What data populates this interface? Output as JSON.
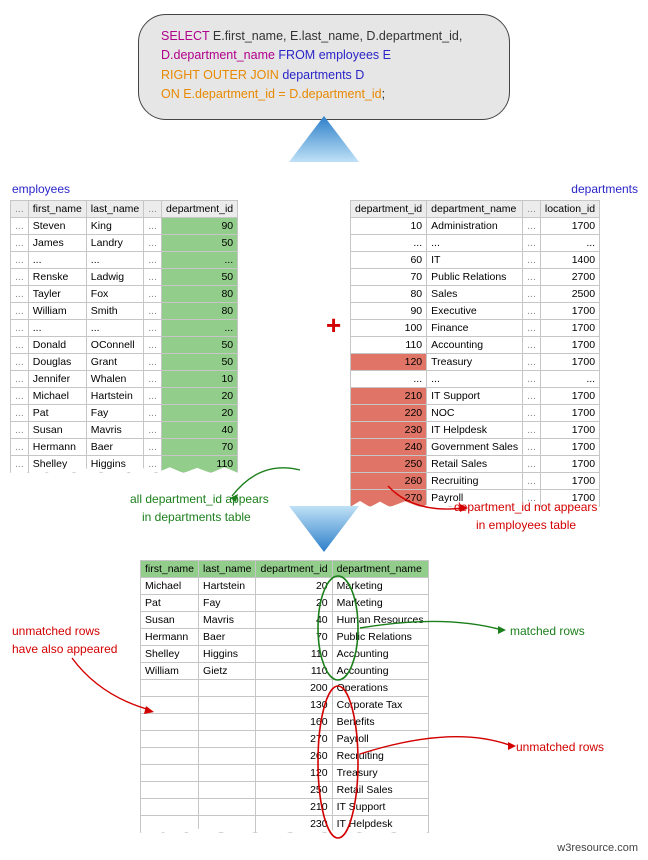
{
  "sql": {
    "line1a": "SELECT",
    "line1b": " E.first_name, E.last_name, D.department_id,",
    "line2a": "D.department_name",
    "line2b": " FROM ",
    "line2c": "employees E",
    "line3a": "RIGHT OUTER JOIN",
    "line3b": " departments D",
    "line4a": "ON",
    "line4b": " E.department_id = D.department_id",
    "line4c": ";"
  },
  "labels": {
    "employees": "employees",
    "departments": "departments",
    "plus": "+",
    "credit": "w3resource.com"
  },
  "annotations": {
    "a1a": "all department_id appears",
    "a1b": "in departments table",
    "a2a": "department_id not appears",
    "a2b": "in employees table",
    "a3a": "unmatched rows",
    "a3b": "have also appeared",
    "a4": "matched rows",
    "a5": "unmatched rows"
  },
  "employees": {
    "cols": [
      "first_name",
      "last_name",
      "department_id"
    ],
    "rows": [
      {
        "fn": "Steven",
        "ln": "King",
        "d": 90
      },
      {
        "fn": "James",
        "ln": "Landry",
        "d": 50
      },
      {
        "gap": true
      },
      {
        "fn": "Renske",
        "ln": "Ladwig",
        "d": 50
      },
      {
        "fn": "Tayler",
        "ln": "Fox",
        "d": 80
      },
      {
        "fn": "William",
        "ln": "Smith",
        "d": 80
      },
      {
        "gap": true
      },
      {
        "fn": "Donald",
        "ln": "OConnell",
        "d": 50
      },
      {
        "fn": "Douglas",
        "ln": "Grant",
        "d": 50
      },
      {
        "fn": "Jennifer",
        "ln": "Whalen",
        "d": 10
      },
      {
        "fn": "Michael",
        "ln": "Hartstein",
        "d": 20
      },
      {
        "fn": "Pat",
        "ln": "Fay",
        "d": 20
      },
      {
        "fn": "Susan",
        "ln": "Mavris",
        "d": 40
      },
      {
        "fn": "Hermann",
        "ln": "Baer",
        "d": 70
      },
      {
        "fn": "Shelley",
        "ln": "Higgins",
        "d": 110
      }
    ]
  },
  "departments": {
    "cols": [
      "department_id",
      "department_name",
      "location_id"
    ],
    "rows": [
      {
        "id": 10,
        "name": "Administration",
        "loc": 1700
      },
      {
        "gap": true
      },
      {
        "id": 60,
        "name": "IT",
        "loc": 1400
      },
      {
        "id": 70,
        "name": "Public Relations",
        "loc": 2700
      },
      {
        "id": 80,
        "name": "Sales",
        "loc": 2500
      },
      {
        "id": 90,
        "name": "Executive",
        "loc": 1700
      },
      {
        "id": 100,
        "name": "Finance",
        "loc": 1700
      },
      {
        "id": 110,
        "name": "Accounting",
        "loc": 1700
      },
      {
        "id": 120,
        "name": "Treasury",
        "loc": 1700,
        "hl": true
      },
      {
        "gap": true
      },
      {
        "id": 210,
        "name": "IT Support",
        "loc": 1700,
        "hl": true
      },
      {
        "id": 220,
        "name": "NOC",
        "loc": 1700,
        "hl": true
      },
      {
        "id": 230,
        "name": "IT Helpdesk",
        "loc": 1700,
        "hl": true
      },
      {
        "id": 240,
        "name": "Government Sales",
        "loc": 1700,
        "hl": true
      },
      {
        "id": 250,
        "name": "Retail Sales",
        "loc": 1700,
        "hl": true
      },
      {
        "id": 260,
        "name": "Recruiting",
        "loc": 1700,
        "hl": true
      },
      {
        "id": 270,
        "name": "Payroll",
        "loc": 1700,
        "hl": true
      }
    ]
  },
  "result": {
    "cols": [
      "first_name",
      "last_name",
      "department_id",
      "department_name"
    ],
    "rows": [
      {
        "fn": "Michael",
        "ln": "Hartstein",
        "d": 20,
        "dn": "Marketing",
        "m": true
      },
      {
        "fn": "Pat",
        "ln": "Fay",
        "d": 20,
        "dn": "Marketing",
        "m": true
      },
      {
        "fn": "Susan",
        "ln": "Mavris",
        "d": 40,
        "dn": "Human Resources",
        "m": true
      },
      {
        "fn": "Hermann",
        "ln": "Baer",
        "d": 70,
        "dn": "Public Relations",
        "m": true
      },
      {
        "fn": "Shelley",
        "ln": "Higgins",
        "d": 110,
        "dn": "Accounting",
        "m": true
      },
      {
        "fn": "William",
        "ln": "Gietz",
        "d": 110,
        "dn": "Accounting",
        "m": true
      },
      {
        "fn": "",
        "ln": "",
        "d": 200,
        "dn": "Operations"
      },
      {
        "fn": "",
        "ln": "",
        "d": 130,
        "dn": "Corporate Tax"
      },
      {
        "fn": "",
        "ln": "",
        "d": 160,
        "dn": "Benefits"
      },
      {
        "fn": "",
        "ln": "",
        "d": 270,
        "dn": "Payroll"
      },
      {
        "fn": "",
        "ln": "",
        "d": 260,
        "dn": "Recruiting"
      },
      {
        "fn": "",
        "ln": "",
        "d": 120,
        "dn": "Treasury"
      },
      {
        "fn": "",
        "ln": "",
        "d": 250,
        "dn": "Retail Sales"
      },
      {
        "fn": "",
        "ln": "",
        "d": 210,
        "dn": "IT Support"
      },
      {
        "fn": "",
        "ln": "",
        "d": 230,
        "dn": "IT Helpdesk"
      }
    ]
  }
}
